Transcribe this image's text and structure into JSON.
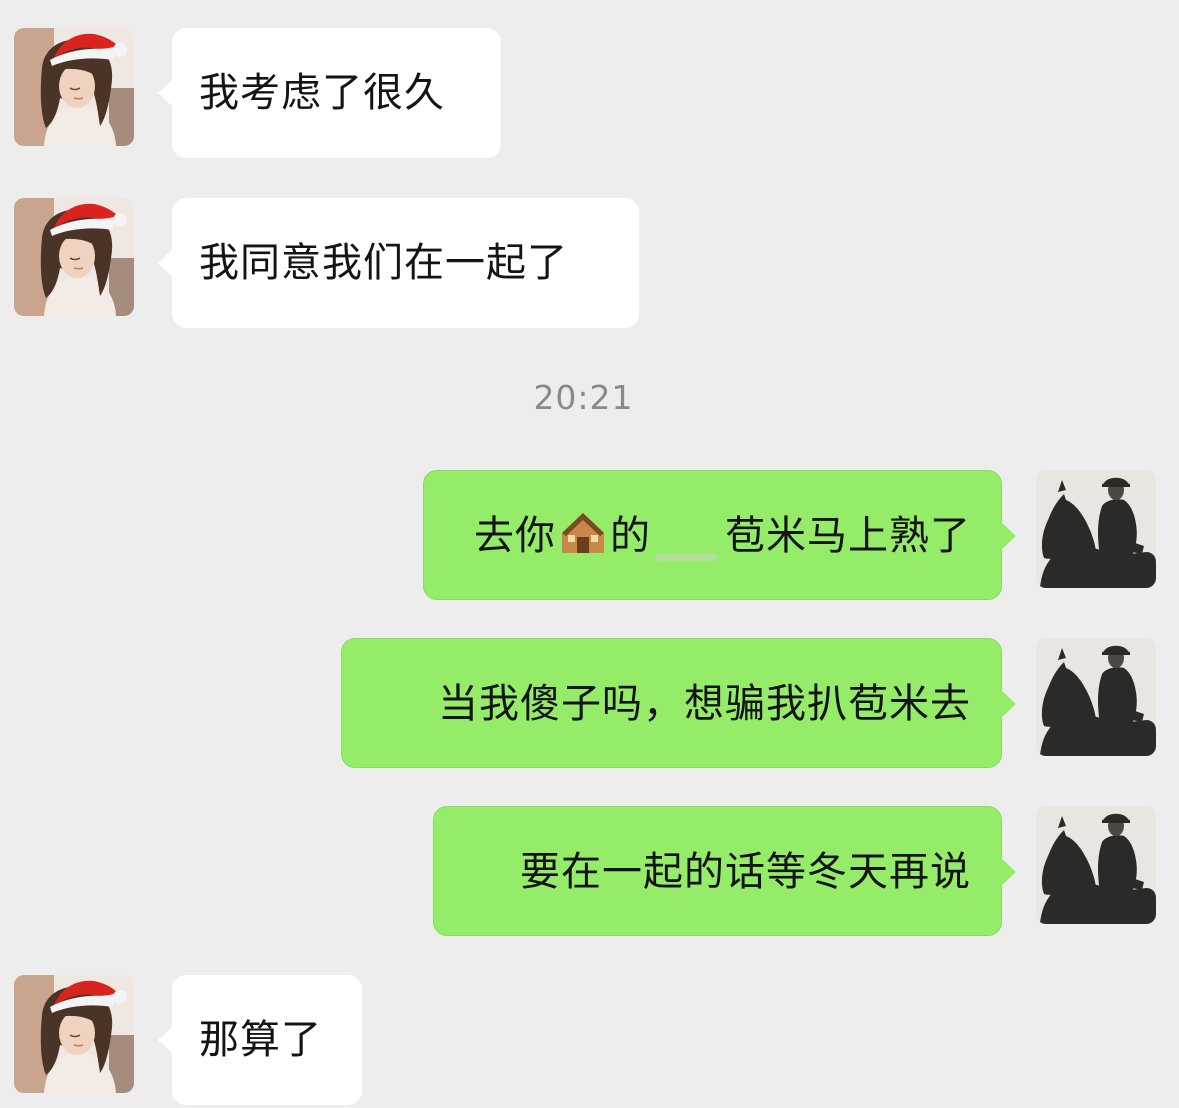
{
  "conversation": {
    "timestamp": "20:21",
    "messages": [
      {
        "sender": "other",
        "text": "我考虑了很久"
      },
      {
        "sender": "other",
        "text": "我同意我们在一起了"
      },
      {
        "sender": "self",
        "text_before_emoji": "去你",
        "emoji": "house-emoji",
        "text_after_emoji": "的",
        "text_after_blur": "苞米马上熟了"
      },
      {
        "sender": "self",
        "text": "当我傻子吗，想骗我扒苞米去"
      },
      {
        "sender": "self",
        "text": "要在一起的话等冬天再说"
      },
      {
        "sender": "other",
        "text": "那算了"
      }
    ]
  },
  "colors": {
    "background": "#ededed",
    "incoming_bubble": "#ffffff",
    "outgoing_bubble": "#95ec69",
    "timestamp_text": "#8a8a8a"
  },
  "avatars": {
    "other": "girl-santa-hat-avatar",
    "self": "horse-rider-silhouette-avatar"
  }
}
